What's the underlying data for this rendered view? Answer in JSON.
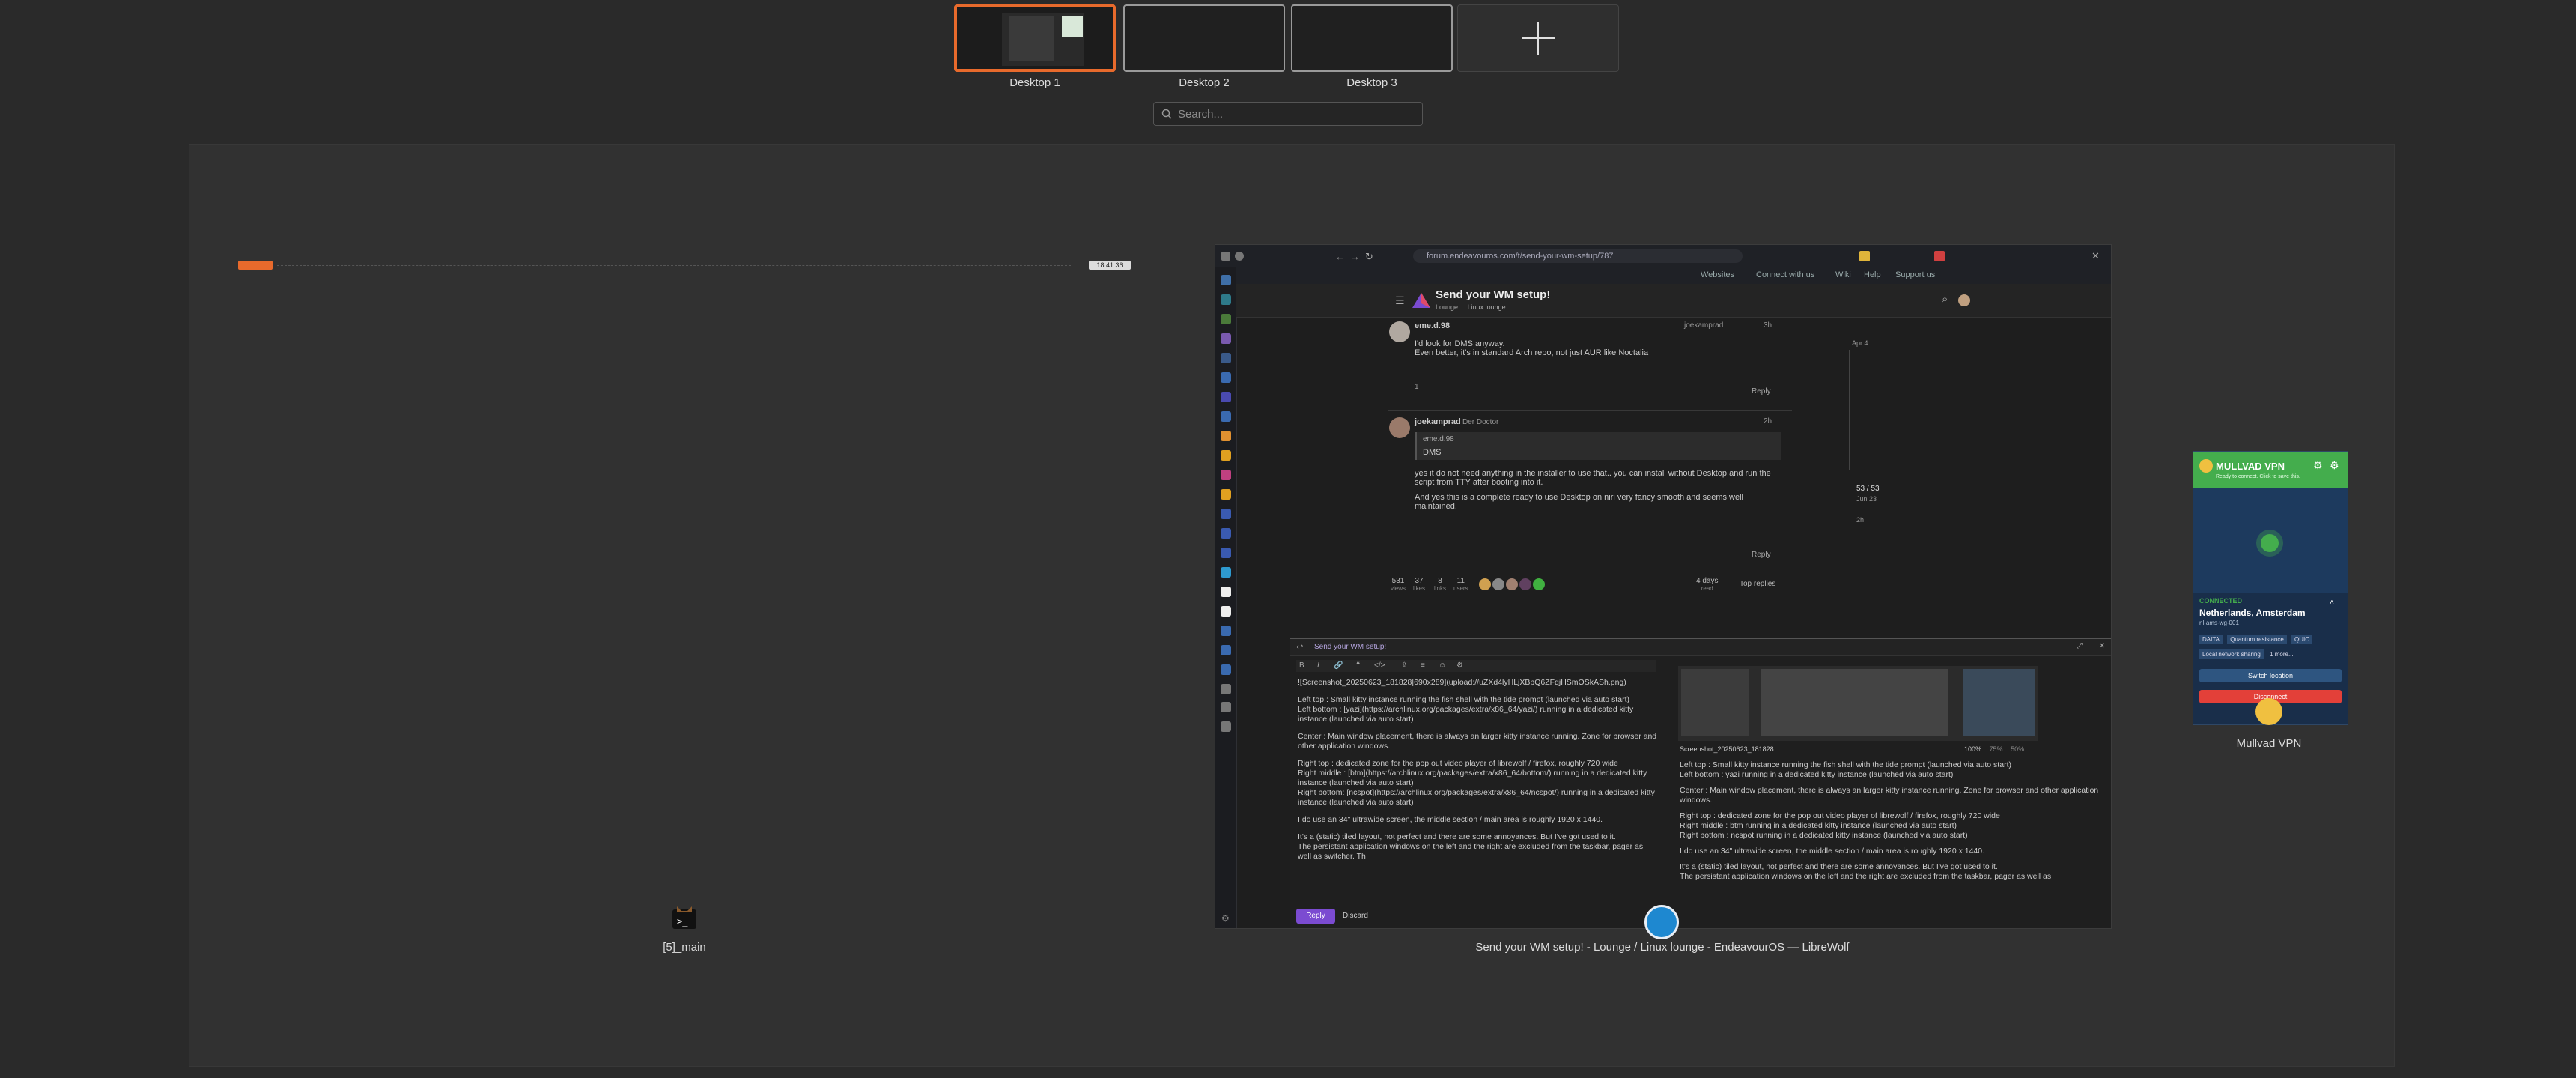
{
  "desktops": [
    {
      "label": "Desktop 1",
      "active": true
    },
    {
      "label": "Desktop 2",
      "active": false
    },
    {
      "label": "Desktop 3",
      "active": false
    }
  ],
  "add_desktop_icon": "plus-icon",
  "search": {
    "placeholder": "Search..."
  },
  "windows": {
    "terminal": {
      "label": "[5]_main"
    },
    "browser": {
      "label": "Send your WM setup! - Lounge / Linux lounge - EndeavourOS — LibreWolf"
    },
    "vpn": {
      "label": "Mullvad VPN"
    }
  },
  "top_bar": {
    "clock": "18:41:36"
  },
  "browser": {
    "url": "forum.endeavouros.com/t/send-your-wm-setup/787",
    "bookmarks": [
      "Websites",
      "Connect with us",
      "Wiki",
      "Help",
      "Support us"
    ],
    "topic_title": "Send your WM setup!",
    "topic_category": "Lounge",
    "topic_subcategory": "Linux lounge",
    "posts": [
      {
        "author": "eme.d.98",
        "reply_to": "joekamprad",
        "time": "3h",
        "text1": "I'd look for DMS anyway.",
        "text2": "Even better, it's in standard Arch repo, not just AUR like Noctalia",
        "reactions": "1",
        "reply_label": "Reply"
      },
      {
        "author": "joekamprad",
        "role": "Der Doctor",
        "time": "2h",
        "quote_author": "eme.d.98",
        "quote_text": "DMS",
        "text1": "yes it do not need anything in the installer to use that.. you can install without Desktop and run the script from TTY after booting into it.",
        "text2": "And yes this is a complete ready to use Desktop on niri very fancy smooth and seems well maintained.",
        "reply_label": "Reply"
      }
    ],
    "topic_stats": [
      {
        "value": "531",
        "label": "views"
      },
      {
        "value": "37",
        "label": "likes"
      },
      {
        "value": "8",
        "label": "links"
      },
      {
        "value": "11",
        "label": "users"
      }
    ],
    "stats_time": "4 days",
    "stats_time_label": "read",
    "top_replies": "Top replies",
    "timeline_date": "Apr 4",
    "timeline_count": "53 / 53",
    "timeline_sub": "Jun 23",
    "timeline_end": "2h"
  },
  "composer": {
    "title": "Send your WM setup!",
    "image_line": "![Screenshot_20250623_181828|690x289](upload://uZXd4lyHLjXBpQ6ZFqjHSmOSkASh.png)",
    "lines": [
      "Left top : Small kitty instance running the fish shell with the tide prompt (launched via auto start)",
      "Left bottom : [yazi](https://archlinux.org/packages/extra/x86_64/yazi/) running in a dedicated kitty instance (launched via auto start)",
      "Center : Main window placement, there is always an larger kitty instance running. Zone for browser and other application windows.",
      "Right top : dedicated zone for the pop out video player of librewolf / firefox, roughly 720 wide",
      "Right middle : [btm](https://archlinux.org/packages/extra/x86_64/bottom/) running in a dedicated kitty instance (launched via auto start)",
      "Right bottom: [ncspot](https://archlinux.org/packages/extra/x86_64/ncspot/) running in a dedicated kitty instance (launched via auto start)",
      "I do use an 34\" ultrawide screen, the middle section / main area is roughly 1920 x 1440.",
      "It's a (static) tiled layout, not perfect and there are some annoyances. But I've got used to it.",
      "The persistant application windows on the left and the right are excluded from the taskbar, pager as well as switcher. Th"
    ],
    "preview_caption": "Screenshot_20250623_181828",
    "zoom_options": [
      "100%",
      "75%",
      "50%"
    ],
    "preview_lines": [
      "Left top : Small kitty instance running the fish shell with the tide prompt (launched via auto start)",
      "Left bottom : yazi running in a dedicated kitty instance (launched via auto start)",
      "Center : Main window placement, there is always an larger kitty instance running. Zone for browser and other application windows.",
      "Right top : dedicated zone for the pop out video player of librewolf / firefox, roughly 720 wide",
      "Right middle : btm running in a dedicated kitty instance (launched via auto start)",
      "Right bottom : ncspot running in a dedicated kitty instance (launched via auto start)",
      "I do use an 34\" ultrawide screen, the middle section / main area is roughly 1920 x 1440.",
      "It's a (static) tiled layout, not perfect and there are some annoyances. But I've got used to it.",
      "The persistant application windows on the left and the right are excluded from the taskbar, pager as well as"
    ],
    "reply_button": "Reply",
    "discard_button": "Discard"
  },
  "vpn": {
    "title": "MULLVAD VPN",
    "subtitle": "Ready to connect. Click to save this.",
    "status": "CONNECTED",
    "location": "Netherlands, Amsterdam",
    "server": "nl-ams-wg-001",
    "tags": [
      "DAITA",
      "Quantum resistance",
      "QUIC"
    ],
    "features": [
      "Local network sharing",
      "1 more..."
    ],
    "switch_button": "Switch location",
    "disconnect_button": "Disconnect"
  },
  "colors": {
    "accent": "#e86a2c",
    "forum_purple": "#7b4bd1",
    "vpn_green": "#44ad4d",
    "vpn_red": "#e34039"
  }
}
